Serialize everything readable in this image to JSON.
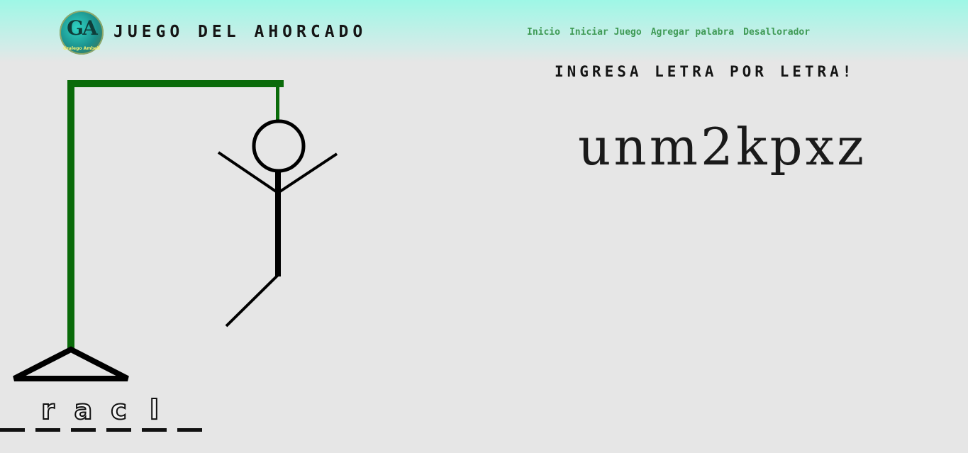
{
  "header": {
    "logo": {
      "mark": "GA",
      "subtitle": "Gralego Ambell"
    },
    "title": "JUEGO DEL AHORCADO",
    "nav": [
      {
        "label": "Inicio"
      },
      {
        "label": "Iniciar Juego"
      },
      {
        "label": "Agregar palabra"
      },
      {
        "label": "Desallorador"
      }
    ]
  },
  "game": {
    "instruction": "INGRESA LETRA POR LETRA!",
    "wrong_letters": "unm2kpxz",
    "word_slots": [
      "",
      "r",
      "a",
      "c",
      "l",
      "",
      ""
    ],
    "hangman_parts_shown": [
      "head",
      "body",
      "left-arm",
      "right-arm",
      "left-leg"
    ],
    "colors": {
      "gallows": "#0a6b0a",
      "figure": "#000000",
      "nav": "#3f9a55"
    }
  }
}
